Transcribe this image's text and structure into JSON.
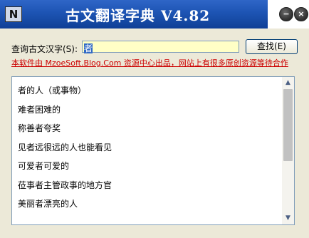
{
  "window": {
    "logo_glyph": "N",
    "title": "古文翻译字典 V4.82",
    "minimize_glyph": "−",
    "close_glyph": "×"
  },
  "query": {
    "label": "查询古文汉字(S):",
    "value": "者",
    "search_label": "查找(E)"
  },
  "notice": "本软件由 MzoeSoft.Blog.Com 资源中心出品，网站上有很多原创资源等待合作",
  "results": [
    "者的人（或事物）",
    "难者困难的",
    "称善者夸奖",
    "见者远很远的人也能看见",
    "可爱者可爱的",
    "莅事者主管政事的地方官",
    "美丽者漂亮的人"
  ],
  "scrollbar": {
    "up_glyph": "▲",
    "down_glyph": "▼"
  }
}
